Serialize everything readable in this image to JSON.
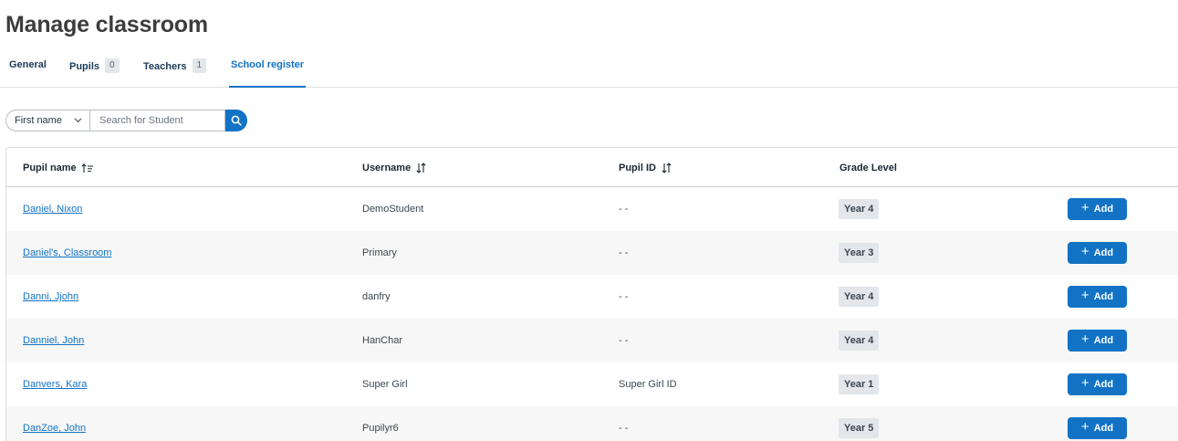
{
  "page": {
    "title": "Manage classroom"
  },
  "tabs": [
    {
      "label": "General",
      "badge": null
    },
    {
      "label": "Pupils",
      "badge": "0"
    },
    {
      "label": "Teachers",
      "badge": "1"
    },
    {
      "label": "School register",
      "badge": null,
      "active": true
    }
  ],
  "search": {
    "filter_value": "First name",
    "placeholder": "Search for Student",
    "icon": "search-icon"
  },
  "table": {
    "columns": [
      {
        "label": "Pupil name",
        "icon": "sort-ascending-icon"
      },
      {
        "label": "Username",
        "icon": "sort-icon"
      },
      {
        "label": "Pupil ID",
        "icon": "sort-icon"
      },
      {
        "label": "Grade Level",
        "icon": null
      }
    ],
    "rows": [
      {
        "name": "Daniel, Nixon",
        "username": "DemoStudent",
        "pupil_id": "- -",
        "grade": "Year 4",
        "action": "Add"
      },
      {
        "name": "Daniel's, Classroom",
        "username": "Primary",
        "pupil_id": "- -",
        "grade": "Year 3",
        "action": "Add"
      },
      {
        "name": "Danni, Jjohn",
        "username": "danfry",
        "pupil_id": "- -",
        "grade": "Year 4",
        "action": "Add"
      },
      {
        "name": "Danniel, John",
        "username": "HanChar",
        "pupil_id": "- -",
        "grade": "Year 4",
        "action": "Add"
      },
      {
        "name": "Danvers, Kara",
        "username": "Super Girl",
        "pupil_id": "Super Girl ID",
        "grade": "Year 1",
        "action": "Add"
      },
      {
        "name": "DanZoe, John",
        "username": "Pupilyr6",
        "pupil_id": "- -",
        "grade": "Year 5",
        "action": "Add"
      }
    ]
  },
  "colors": {
    "accent": "#1273c5",
    "badge_bg": "#e3e6ea",
    "title": "#3d3d3d"
  }
}
